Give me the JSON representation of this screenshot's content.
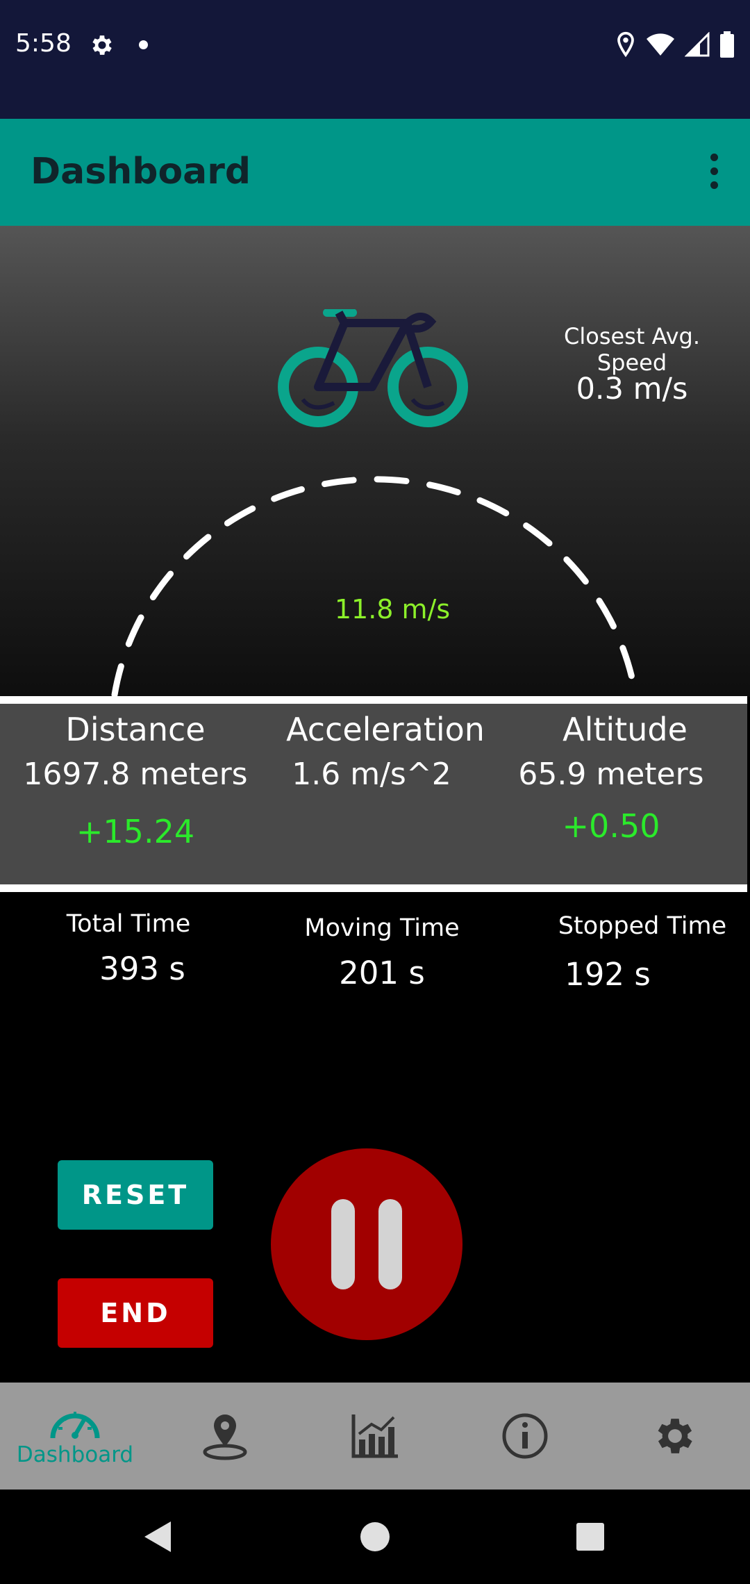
{
  "status_bar": {
    "time": "5:58"
  },
  "app_bar": {
    "title": "Dashboard"
  },
  "speed_panel": {
    "closest_avg_label": "Closest Avg. Speed",
    "closest_avg_value": "0.3 m/s",
    "current_speed": "11.8 m/s"
  },
  "stats": {
    "distance": {
      "label": "Distance",
      "value": "1697.8 meters",
      "delta": "+15.24"
    },
    "acceleration": {
      "label": "Acceleration",
      "value": "1.6 m/s^2"
    },
    "altitude": {
      "label": "Altitude",
      "value": "65.9 meters",
      "delta": "+0.50"
    }
  },
  "times": {
    "total": {
      "label": "Total Time",
      "value": "393 s"
    },
    "moving": {
      "label": "Moving Time",
      "value": "201 s"
    },
    "stopped": {
      "label": "Stopped Time",
      "value": "192 s"
    }
  },
  "controls": {
    "reset_label": "RESET",
    "end_label": "END"
  },
  "bottom_nav": {
    "items": [
      {
        "label": "Dashboard",
        "icon": "speedometer-icon",
        "active": true
      },
      {
        "label": "",
        "icon": "map-pin-icon",
        "active": false
      },
      {
        "label": "",
        "icon": "chart-icon",
        "active": false
      },
      {
        "label": "",
        "icon": "info-icon",
        "active": false
      },
      {
        "label": "",
        "icon": "gear-icon",
        "active": false
      }
    ]
  },
  "colors": {
    "primary": "#009688",
    "status_bar": "#131739",
    "speed_green": "#8cf02a",
    "delta_green": "#2bea2b",
    "end_red": "#c50000",
    "pause_red": "#a10000"
  }
}
